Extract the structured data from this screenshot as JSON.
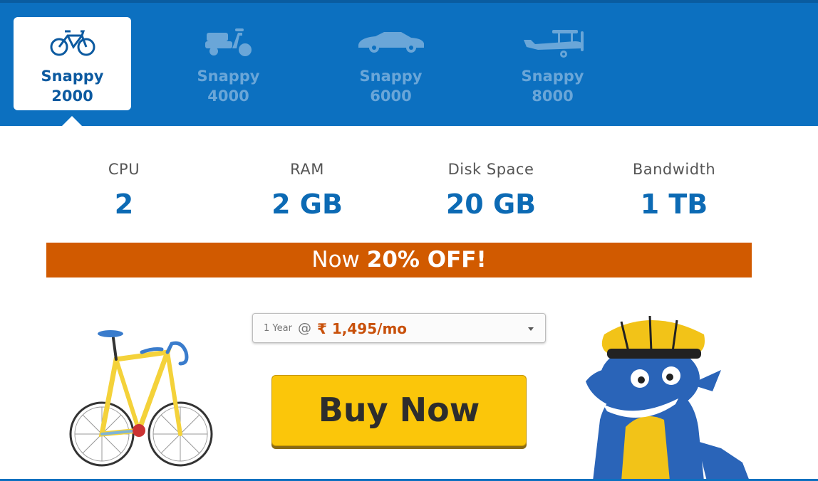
{
  "plans": [
    {
      "name": "Snappy",
      "number": "2000",
      "icon": "bicycle-icon",
      "active": true
    },
    {
      "name": "Snappy",
      "number": "4000",
      "icon": "scooter-icon",
      "active": false
    },
    {
      "name": "Snappy",
      "number": "6000",
      "icon": "car-icon",
      "active": false
    },
    {
      "name": "Snappy",
      "number": "8000",
      "icon": "airplane-icon",
      "active": false
    }
  ],
  "specs": [
    {
      "label": "CPU",
      "value": "2"
    },
    {
      "label": "RAM",
      "value": "2 GB"
    },
    {
      "label": "Disk Space",
      "value": "20 GB"
    },
    {
      "label": "Bandwidth",
      "value": "1 TB"
    }
  ],
  "promo": {
    "prefix": "Now",
    "highlight": "20% OFF!"
  },
  "billing": {
    "term": "1 Year",
    "at": "@",
    "price": "₹ 1,495/mo"
  },
  "buy_button": "Buy Now",
  "colors": {
    "brand_blue": "#0c70c0",
    "promo_orange": "#d15a00",
    "buy_yellow": "#fbc60a",
    "price_orange": "#c8500a"
  }
}
